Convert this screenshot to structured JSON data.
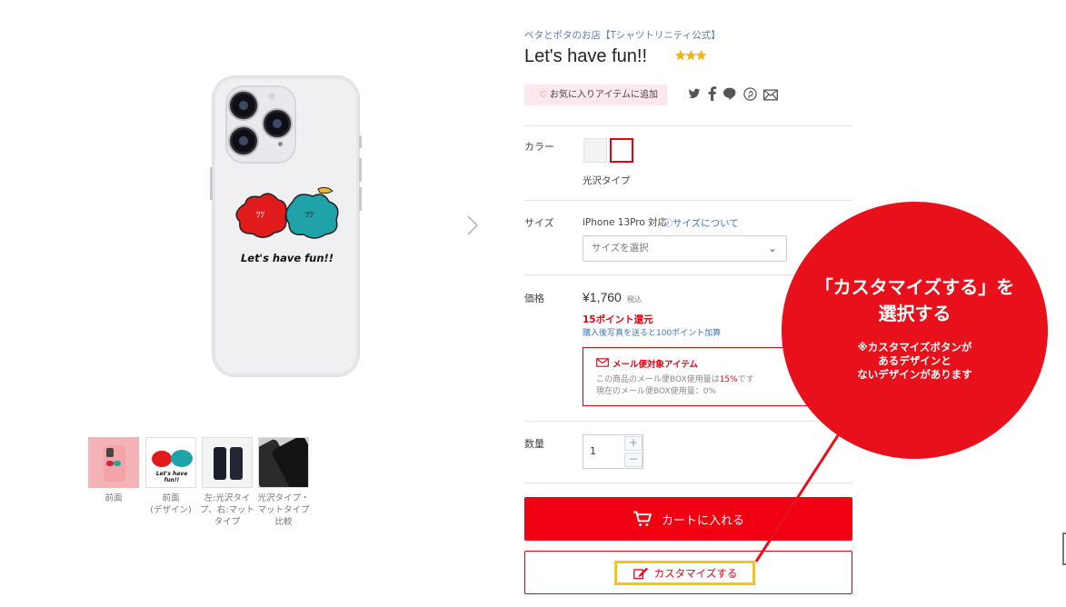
{
  "shop_name": "ペタとポタのお店【Tシャツトリニティ公式】",
  "product_title": "Let's have fun!!",
  "title_stars": "★★★",
  "favorite_label": "お気に入りアイテムに追加",
  "share_icons": [
    "twitter-icon",
    "facebook-icon",
    "line-icon",
    "pinterest-icon",
    "mail-icon"
  ],
  "color": {
    "label": "カラー",
    "swatches": [
      "#f3f3f3",
      "#ffffff"
    ],
    "selected_name": "光沢タイプ"
  },
  "size": {
    "label": "サイズ",
    "model": "iPhone 13Pro 対応",
    "guide_link": "サイズについて",
    "select_placeholder": "サイズを選択"
  },
  "price": {
    "label": "価格",
    "value": "¥1,760",
    "tax_label": "税込",
    "points": "15ポイント還元",
    "bonus": "購入後写真を送ると100ポイント加算"
  },
  "mail": {
    "title": "メール便対象アイテム",
    "usage_prefix": "この商品のメール便BOX使用量は",
    "usage_pct": "15%",
    "usage_suffix": "です",
    "current": "現在のメール便BOX使用量：0%"
  },
  "quantity": {
    "label": "数量",
    "value": "1",
    "plus": "+",
    "minus": "−"
  },
  "cart_button": "カートに入れる",
  "customize_button": "カスタマイズする",
  "design_text": "Let's have fun!!",
  "thumbnails": [
    {
      "caption": "前面"
    },
    {
      "caption": "前面\n(デザイン)"
    },
    {
      "caption": "左:光沢タイプ、右:マットタイプ"
    },
    {
      "caption": "光沢タイプ・マットタイプ比較"
    }
  ],
  "callout": {
    "title_line1": "「カスタマイズする」を",
    "title_line2": "選択する",
    "note_line1": "※カスタマイズボタンが",
    "note_line2": "あるデザインと",
    "note_line3": "ないデザインがあります"
  },
  "colors": {
    "accent_red": "#e60012",
    "link_blue": "#3c78b4",
    "highlight_yellow": "#f5c518"
  }
}
